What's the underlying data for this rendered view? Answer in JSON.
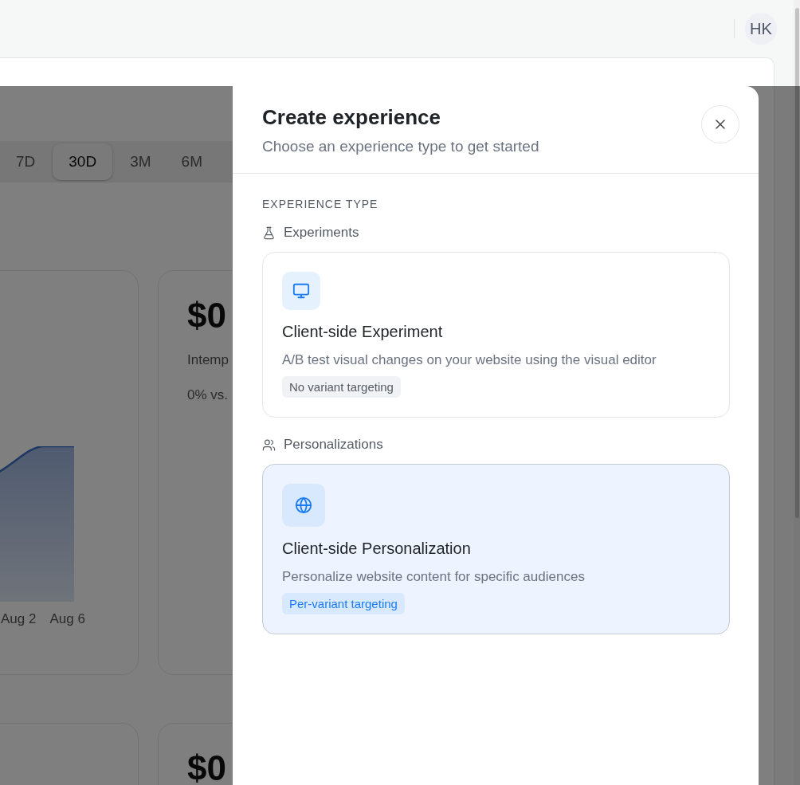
{
  "header": {
    "avatar": "HK"
  },
  "range_tabs": [
    {
      "label": "7D",
      "selected": false
    },
    {
      "label": "30D",
      "selected": true
    },
    {
      "label": "3M",
      "selected": false
    },
    {
      "label": "6M",
      "selected": false
    }
  ],
  "cards": [
    {
      "kind": "chart",
      "x_labels": [
        "Aug 2",
        "Aug 6"
      ]
    },
    {
      "kind": "metric",
      "value": "$0",
      "label": "Intemp",
      "change": "0% vs."
    },
    {
      "kind": "empty"
    },
    {
      "kind": "metric",
      "value": "$0"
    }
  ],
  "dialog": {
    "title": "Create experience",
    "subtitle": "Choose an experience type to get started",
    "section_label": "EXPERIENCE TYPE",
    "groups": [
      {
        "label": "Experiments",
        "options": [
          {
            "title": "Client-side Experiment",
            "description": "A/B test visual changes on your website using the visual editor",
            "badge": "No variant targeting",
            "selected": false
          }
        ]
      },
      {
        "label": "Personalizations",
        "options": [
          {
            "title": "Client-side Personalization",
            "description": "Personalize website content for specific audiences",
            "badge": "Per-variant targeting",
            "selected": true
          }
        ]
      }
    ]
  }
}
